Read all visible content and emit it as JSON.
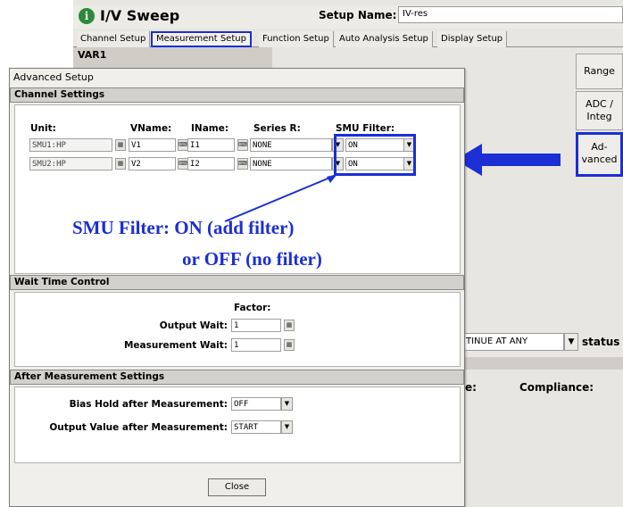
{
  "app": {
    "logo_glyph": "i",
    "title": "I/V Sweep",
    "setup_name_label": "Setup Name:",
    "setup_name_value": "IV-res"
  },
  "tabs": [
    {
      "label": "Channel Setup",
      "active": false
    },
    {
      "label": "Measurement Setup",
      "active": true
    },
    {
      "label": "Function Setup",
      "active": false
    },
    {
      "label": "Auto Analysis Setup",
      "active": false
    },
    {
      "label": "Display Setup",
      "active": false
    }
  ],
  "var1_label": "VAR1",
  "side_buttons": {
    "range": "Range",
    "adc_line1": "ADC /",
    "adc_line2": "Integ",
    "advanced_line1": "Ad-",
    "advanced_line2": "vanced"
  },
  "background": {
    "stop_condition_value": "TINUE AT ANY",
    "status_label": "status",
    "e_label": "e:",
    "compliance_label": "Compliance:"
  },
  "dialog": {
    "title": "Advanced Setup",
    "channel_settings": {
      "header": "Channel Settings",
      "columns": {
        "unit": "Unit:",
        "vname": "VName:",
        "iname": "IName:",
        "series_r": "Series R:",
        "smu_filter": "SMU Filter:"
      },
      "rows": [
        {
          "unit": "SMU1:HP",
          "vname": "V1",
          "iname": "I1",
          "series_r": "NONE",
          "smu_filter": "ON"
        },
        {
          "unit": "SMU2:HP",
          "vname": "V2",
          "iname": "I2",
          "series_r": "NONE",
          "smu_filter": "ON"
        }
      ]
    },
    "wait_time_control": {
      "header": "Wait Time Control",
      "factor_label": "Factor:",
      "output_wait_label": "Output Wait:",
      "output_wait_value": "1",
      "measurement_wait_label": "Measurement Wait:",
      "measurement_wait_value": "1"
    },
    "after_measurement": {
      "header": "After Measurement Settings",
      "bias_hold_label": "Bias Hold after Measurement:",
      "bias_hold_value": "OFF",
      "output_value_label": "Output Value after Measurement:",
      "output_value_value": "START"
    },
    "close_label": "Close"
  },
  "annotation": {
    "line1": "SMU Filter: ON (add filter)",
    "line2": "or OFF (no filter)",
    "color": "#1b2fd4"
  },
  "colors": {
    "highlight_blue": "#1b2fd4",
    "window_bg": "#e8e6e0",
    "section_bar": "#d3d1cb"
  },
  "icons": {
    "dropdown": "chevron-down-icon",
    "calc": "calculator-icon",
    "keyboard": "keyboard-icon",
    "arrow": "arrow-left-icon"
  }
}
